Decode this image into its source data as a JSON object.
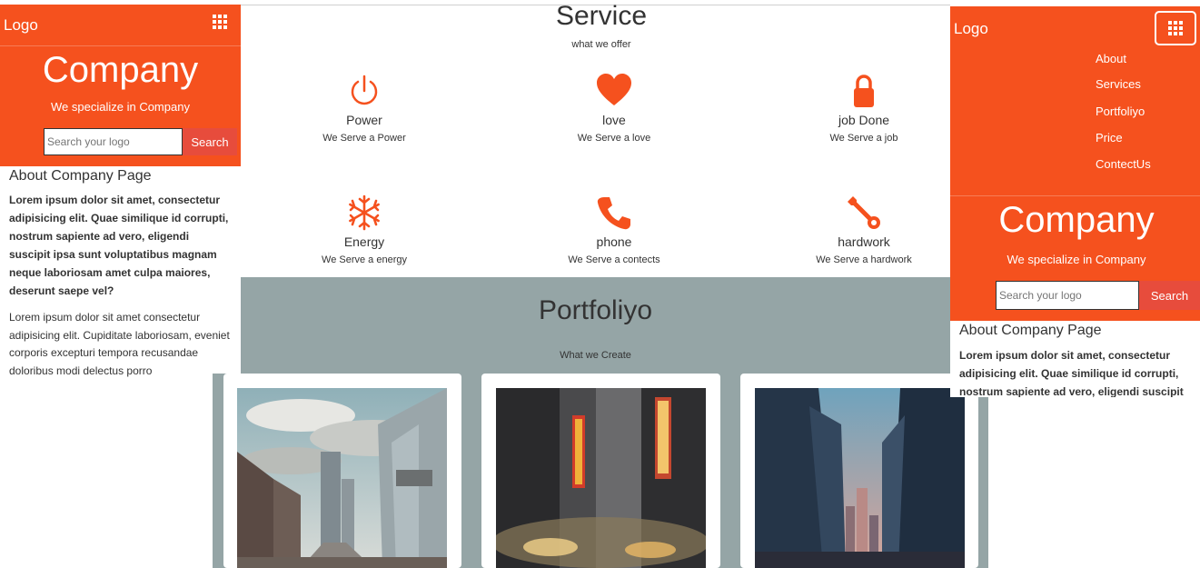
{
  "left": {
    "logo": "Logo",
    "company": "Company",
    "tagline": "We specialize in Company",
    "search_placeholder": "Search your logo",
    "search_button": "Search",
    "about_title": "About Company Page",
    "about_bold": "Lorem ipsum dolor sit amet, consectetur adipisicing elit. Quae similique id corrupti, nostrum sapiente ad vero, eligendi suscipit ipsa sunt voluptatibus magnam neque laboriosam amet culpa maiores, deserunt saepe vel?",
    "about_regular": "Lorem ipsum dolor sit amet consectetur adipisicing elit. Cupiditate laboriosam, eveniet corporis excepturi tempora recusandae doloribus modi delectus porro"
  },
  "service": {
    "title": "Service",
    "subtitle": "what we offer",
    "items": [
      {
        "name": "Power",
        "desc": "We Serve a Power",
        "icon": "power-icon"
      },
      {
        "name": "love",
        "desc": "We Serve a love",
        "icon": "heart-icon"
      },
      {
        "name": "job Done",
        "desc": "We Serve a job",
        "icon": "lock-icon"
      },
      {
        "name": "Energy",
        "desc": "We Serve a energy",
        "icon": "snowflake-icon"
      },
      {
        "name": "phone",
        "desc": "We Serve a contects",
        "icon": "phone-icon"
      },
      {
        "name": "hardwork",
        "desc": "We Serve a hardwork",
        "icon": "wrench-icon"
      }
    ]
  },
  "portfolio": {
    "title": "Portfoliyo",
    "subtitle": "What we Create"
  },
  "right": {
    "logo": "Logo",
    "menu": [
      "About",
      "Services",
      "Portfoliyo",
      "Price",
      "ContectUs"
    ],
    "company": "Company",
    "tagline": "We specialize in Company",
    "search_placeholder": "Search your logo",
    "search_button": "Search",
    "about_title": "About Company Page",
    "about_bold": "Lorem ipsum dolor sit amet, consectetur adipisicing elit. Quae similique id corrupti, nostrum sapiente ad vero, eligendi suscipit"
  },
  "colors": {
    "accent": "#f5511e",
    "button": "#e74c3c",
    "portfolio_bg": "#95a5a6"
  }
}
